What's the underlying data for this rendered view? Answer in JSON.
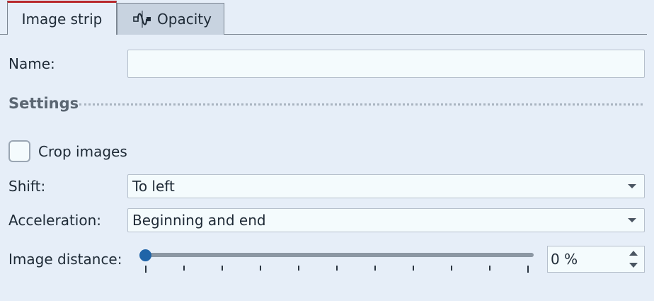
{
  "tabs": [
    {
      "label": "Image strip",
      "active": true
    },
    {
      "label": "Opacity",
      "active": false,
      "icon": "opacity-curve-icon"
    }
  ],
  "colors": {
    "active_tab_accent": "#b8282c",
    "slider_thumb": "#1f64a8",
    "background": "#e6eef8"
  },
  "form": {
    "name_label": "Name:",
    "name_value": "",
    "settings_title": "Settings",
    "crop_label": "Crop images",
    "crop_checked": false,
    "shift_label": "Shift:",
    "shift_value": "To left",
    "acceleration_label": "Acceleration:",
    "acceleration_value": "Beginning and end",
    "distance_label": "Image distance:",
    "distance_value": "0 %",
    "distance_slider_fraction": 0,
    "distance_tick_count": 11
  }
}
